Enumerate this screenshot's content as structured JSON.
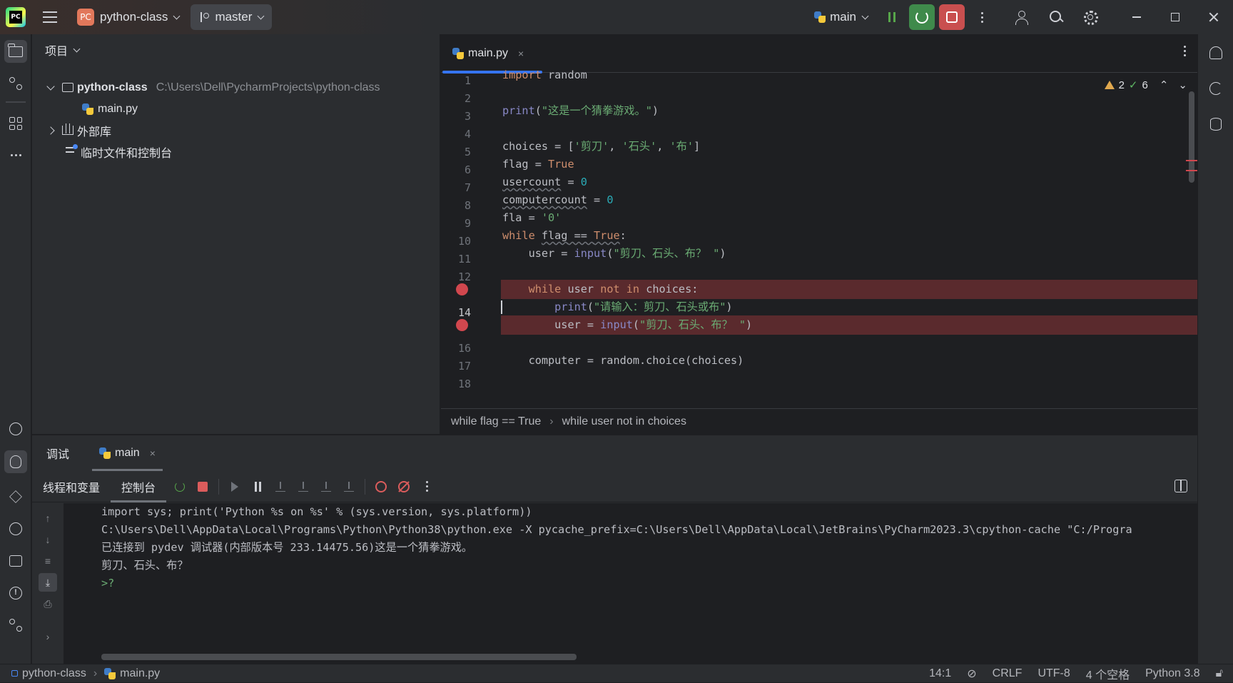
{
  "titlebar": {
    "project_badge": "PC",
    "project_name": "python-class",
    "branch": "master",
    "run_config": "main"
  },
  "project_panel": {
    "title": "项目",
    "root_folder": "python-class",
    "root_path": "C:\\Users\\Dell\\PycharmProjects\\python-class",
    "file": "main.py",
    "external_libs": "外部库",
    "scratches": "临时文件和控制台"
  },
  "editor": {
    "tab_label": "main.py",
    "tab_close": "×",
    "warnings": "2",
    "ok_count": "6",
    "line_numbers": [
      "1",
      "2",
      "3",
      "4",
      "5",
      "6",
      "7",
      "8",
      "9",
      "10",
      "11",
      "12",
      "",
      "14",
      "",
      "16",
      "17",
      "18"
    ],
    "breadcrumb": [
      "while flag == True",
      "while user not in choices"
    ],
    "code": {
      "l1_kw": "import",
      "l1_rest": " random",
      "l3_fn": "print",
      "l3_str": "\"这是一个猜拳游戏。\"",
      "l5_var": "choices",
      "l5_s1": "'剪刀'",
      "l5_s2": "'石头'",
      "l5_s3": "'布'",
      "l6_var": "flag",
      "l6_val": "True",
      "l7_var": "usercount",
      "l7_val": "0",
      "l8_var": "computercount",
      "l8_val": "0",
      "l9_var": "fla",
      "l9_val": "'0'",
      "l10_kw": "while",
      "l10_var": "flag",
      "l10_val": "True",
      "l11_var": "user",
      "l11_fn": "input",
      "l11_str": "\"剪刀、石头、布？ \"",
      "l13_kw1": "while",
      "l13_var": "user",
      "l13_kw2": "not in",
      "l13_rest": " choices:",
      "l14_fn": "print",
      "l14_str": "\"请输入：剪刀、石头或布\"",
      "l15_var": "user",
      "l15_fn": "input",
      "l15_str": "\"剪刀、石头、布？ \"",
      "l17_rest": "computer = random.choice(choices)"
    }
  },
  "debug_panel": {
    "title": "调试",
    "session_tab": "main",
    "sub_tabs": [
      "线程和变量",
      "控制台"
    ],
    "console_lines": [
      "import sys; print('Python %s on %s' % (sys.version, sys.platform))",
      "C:\\Users\\Dell\\AppData\\Local\\Programs\\Python\\Python38\\python.exe -X pycache_prefix=C:\\Users\\Dell\\AppData\\Local\\JetBrains\\PyCharm2023.3\\cpython-cache \"C:/Progra",
      "已连接到 pydev 调试器(内部版本号 233.14475.56)这是一个猜拳游戏。",
      "剪刀、石头、布？"
    ],
    "prompt": ">?"
  },
  "statusbar": {
    "project": "python-class",
    "file": "main.py",
    "position": "14:1",
    "line_sep": "CRLF",
    "encoding": "UTF-8",
    "indent": "4 个空格",
    "interpreter": "Python 3.8"
  },
  "colors": {
    "accent": "#3574f0",
    "breakpoint": "#d1474e",
    "string": "#6aab73",
    "keyword": "#cf8e6d"
  }
}
